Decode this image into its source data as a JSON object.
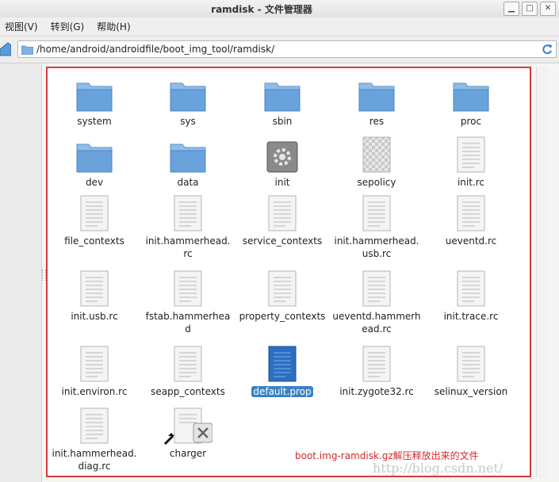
{
  "window": {
    "title": "ramdisk - 文件管理器"
  },
  "menu": [
    "视图(V)",
    "转到(G)",
    "帮助(H)"
  ],
  "path": "/home/android/androidfile/boot_img_tool/ramdisk/",
  "files": [
    {
      "line1": "system",
      "line2": "",
      "kind": "folder"
    },
    {
      "line1": "sys",
      "line2": "",
      "kind": "folder"
    },
    {
      "line1": "sbin",
      "line2": "",
      "kind": "folder"
    },
    {
      "line1": "res",
      "line2": "",
      "kind": "folder"
    },
    {
      "line1": "proc",
      "line2": "",
      "kind": "folder"
    },
    {
      "line1": "dev",
      "line2": "",
      "kind": "folder"
    },
    {
      "line1": "data",
      "line2": "",
      "kind": "folder"
    },
    {
      "line1": "init",
      "line2": "",
      "kind": "executable"
    },
    {
      "line1": "sepolicy",
      "line2": "",
      "kind": "binary"
    },
    {
      "line1": "init.rc",
      "line2": "",
      "kind": "text"
    },
    {
      "line1": "file_contexts",
      "line2": "",
      "kind": "text"
    },
    {
      "line1": "init.hammerhead.",
      "line2": "rc",
      "kind": "text"
    },
    {
      "line1": "service_contexts",
      "line2": "",
      "kind": "text"
    },
    {
      "line1": "init.hammerhead.",
      "line2": "usb.rc",
      "kind": "text"
    },
    {
      "line1": "ueventd.rc",
      "line2": "",
      "kind": "text"
    },
    {
      "line1": "init.usb.rc",
      "line2": "",
      "kind": "text"
    },
    {
      "line1": "fstab.hammerhea",
      "line2": "d",
      "kind": "text"
    },
    {
      "line1": "property_contexts",
      "line2": "",
      "kind": "text"
    },
    {
      "line1": "ueventd.hammerh",
      "line2": "ead.rc",
      "kind": "text"
    },
    {
      "line1": "init.trace.rc",
      "line2": "",
      "kind": "text"
    },
    {
      "line1": "init.environ.rc",
      "line2": "",
      "kind": "text"
    },
    {
      "line1": "seapp_contexts",
      "line2": "",
      "kind": "text"
    },
    {
      "line1": "default.prop",
      "line2": "",
      "kind": "text",
      "selected": true
    },
    {
      "line1": "init.zygote32.rc",
      "line2": "",
      "kind": "text"
    },
    {
      "line1": "selinux_version",
      "line2": "",
      "kind": "text"
    },
    {
      "line1": "init.hammerhead.",
      "line2": "diag.rc",
      "kind": "text"
    },
    {
      "line1": "charger",
      "line2": "",
      "kind": "broken-link"
    }
  ],
  "annotation": "boot.img-ramdisk.gz解压释放出来的文件",
  "watermark": "http://blog.csdn.net/",
  "colors": {
    "annotation": "#d62828",
    "selection": "#3b82c4",
    "border": "#d93a3a"
  }
}
